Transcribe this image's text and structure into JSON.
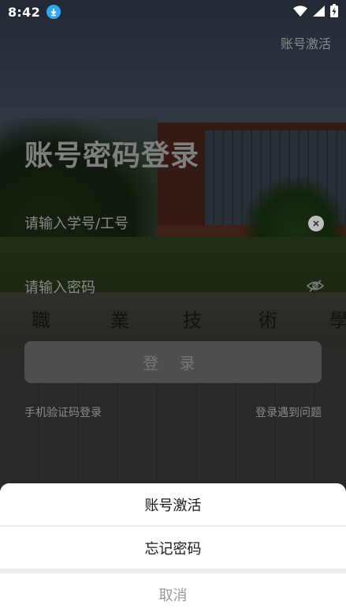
{
  "status_bar": {
    "time": "8:42"
  },
  "header": {
    "activate_link": "账号激活"
  },
  "login": {
    "title": "账号密码登录",
    "username_placeholder": "请输入学号/工号",
    "password_placeholder": "请输入密码",
    "login_button": "登 录",
    "sms_login": "手机验证码登录",
    "login_problem": "登录遇到问题"
  },
  "background": {
    "rock_characters": [
      "職",
      "業",
      "技",
      "術",
      "學"
    ]
  },
  "action_sheet": {
    "items": [
      "账号激活",
      "忘记密码"
    ],
    "cancel": "取消"
  },
  "colors": {
    "accent_download": "#2ea7f2"
  }
}
